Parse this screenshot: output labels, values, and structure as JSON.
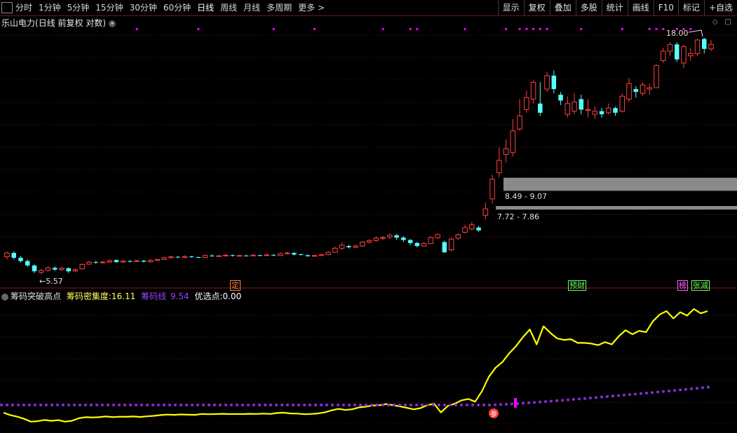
{
  "toolbar": {
    "periods": [
      "分时",
      "1分钟",
      "5分钟",
      "15分钟",
      "30分钟",
      "60分钟",
      "日线",
      "周线",
      "月线",
      "多周期",
      "更多 >"
    ],
    "active_period": "日线",
    "buttons": [
      "显示",
      "复权",
      "叠加",
      "多股",
      "统计",
      "画线",
      "F10",
      "标记",
      "+自选"
    ]
  },
  "header": {
    "stock_name": "乐山电力",
    "params": "(日线 前复权 对数)"
  },
  "price_labels": {
    "high": "18.00",
    "low": "5.57",
    "zone_upper": "8.49 - 9.07",
    "zone_lower": "7.72 - 7.86"
  },
  "event_tags": {
    "ding": "定",
    "yucai": "预财",
    "bang": "榜",
    "zhangjian": "张减"
  },
  "indicator": {
    "name": "筹码突破高点",
    "density_label": "筹码密集度:",
    "density_value": "16.11",
    "line_label": "筹码线",
    "line_value": "9.54",
    "pick_label": "优选点:",
    "pick_value": "0.00",
    "marker_text": "参"
  },
  "colors": {
    "up": "#ff4040",
    "down": "#54ffff",
    "grid": "#6a1010",
    "magenta": "#ff00ff",
    "yellow": "#ffff00",
    "purple": "#8a2be2"
  },
  "chart_data": {
    "type": "candlestick",
    "candles": [
      [
        6.08,
        6.2,
        6.24,
        6.0
      ],
      [
        6.2,
        6.05,
        6.25,
        6.0
      ],
      [
        6.05,
        5.95,
        6.1,
        5.9
      ],
      [
        5.95,
        5.82,
        6.0,
        5.78
      ],
      [
        5.82,
        5.65,
        5.85,
        5.6
      ],
      [
        5.62,
        5.68,
        5.72,
        5.57
      ],
      [
        5.68,
        5.75,
        5.8,
        5.64
      ],
      [
        5.75,
        5.7,
        5.79,
        5.66
      ],
      [
        5.7,
        5.74,
        5.78,
        5.66
      ],
      [
        5.74,
        5.65,
        5.76,
        5.6
      ],
      [
        5.66,
        5.7,
        5.73,
        5.62
      ],
      [
        5.72,
        5.85,
        5.88,
        5.7
      ],
      [
        5.86,
        5.92,
        5.96,
        5.84
      ],
      [
        5.92,
        5.9,
        5.96,
        5.87
      ],
      [
        5.9,
        5.92,
        5.96,
        5.88
      ],
      [
        5.92,
        5.96,
        6.0,
        5.9
      ],
      [
        5.98,
        5.92,
        6.0,
        5.9
      ],
      [
        5.92,
        5.95,
        5.98,
        5.9
      ],
      [
        5.95,
        5.94,
        5.98,
        5.91
      ],
      [
        5.94,
        5.96,
        5.99,
        5.92
      ],
      [
        5.96,
        5.93,
        5.98,
        5.91
      ],
      [
        5.93,
        5.97,
        6.0,
        5.91
      ],
      [
        5.97,
        6.0,
        6.03,
        5.95
      ],
      [
        6.0,
        6.05,
        6.08,
        5.98
      ],
      [
        6.05,
        6.08,
        6.11,
        6.03
      ],
      [
        6.08,
        6.06,
        6.1,
        6.04
      ],
      [
        6.06,
        6.09,
        6.12,
        6.04
      ],
      [
        6.09,
        6.07,
        6.11,
        6.05
      ],
      [
        6.07,
        6.06,
        6.09,
        6.04
      ],
      [
        6.06,
        6.12,
        6.15,
        6.05
      ],
      [
        6.12,
        6.1,
        6.15,
        6.08
      ],
      [
        6.1,
        6.11,
        6.14,
        6.08
      ],
      [
        6.11,
        6.13,
        6.16,
        6.09
      ],
      [
        6.13,
        6.11,
        6.15,
        6.09
      ],
      [
        6.11,
        6.12,
        6.14,
        6.09
      ],
      [
        6.12,
        6.11,
        6.14,
        6.09
      ],
      [
        6.11,
        6.13,
        6.16,
        6.1
      ],
      [
        6.13,
        6.12,
        6.15,
        6.1
      ],
      [
        6.12,
        6.14,
        6.17,
        6.1
      ],
      [
        6.14,
        6.12,
        6.16,
        6.1
      ],
      [
        6.12,
        6.18,
        6.21,
        6.1
      ],
      [
        6.18,
        6.2,
        6.24,
        6.15
      ],
      [
        6.2,
        6.15,
        6.23,
        6.12
      ],
      [
        6.16,
        6.14,
        6.18,
        6.12
      ],
      [
        6.13,
        6.1,
        6.16,
        6.08
      ],
      [
        6.1,
        6.12,
        6.15,
        6.08
      ],
      [
        6.12,
        6.15,
        6.18,
        6.1
      ],
      [
        6.15,
        6.22,
        6.26,
        6.13
      ],
      [
        6.22,
        6.35,
        6.4,
        6.2
      ],
      [
        6.35,
        6.45,
        6.55,
        6.3
      ],
      [
        6.42,
        6.38,
        6.46,
        6.34
      ],
      [
        6.38,
        6.42,
        6.47,
        6.35
      ],
      [
        6.42,
        6.55,
        6.58,
        6.4
      ],
      [
        6.55,
        6.6,
        6.65,
        6.5
      ],
      [
        6.6,
        6.68,
        6.75,
        6.56
      ],
      [
        6.68,
        6.7,
        6.75,
        6.62
      ],
      [
        6.72,
        6.78,
        6.85,
        6.66
      ],
      [
        6.78,
        6.7,
        6.82,
        6.62
      ],
      [
        6.7,
        6.62,
        6.75,
        6.55
      ],
      [
        6.62,
        6.52,
        6.65,
        6.45
      ],
      [
        6.52,
        6.42,
        6.56,
        6.38
      ],
      [
        6.42,
        6.5,
        6.55,
        6.4
      ],
      [
        6.5,
        6.7,
        6.75,
        6.48
      ],
      [
        6.7,
        6.8,
        6.85,
        6.65
      ],
      [
        6.55,
        6.22,
        6.6,
        6.2
      ],
      [
        6.3,
        6.65,
        6.7,
        6.25
      ],
      [
        6.68,
        6.8,
        6.85,
        6.62
      ],
      [
        6.88,
        7.05,
        7.15,
        6.85
      ],
      [
        7.0,
        7.15,
        7.25,
        6.95
      ],
      [
        7.05,
        6.95,
        7.1,
        6.9
      ],
      [
        7.5,
        7.75,
        8.0,
        7.35
      ],
      [
        8.15,
        9.0,
        9.2,
        7.95
      ],
      [
        9.3,
        9.9,
        10.6,
        9.1
      ],
      [
        10.2,
        10.5,
        11.0,
        9.8
      ],
      [
        10.3,
        11.5,
        12.2,
        10.1
      ],
      [
        11.6,
        12.4,
        13.5,
        11.5
      ],
      [
        12.8,
        13.6,
        14.1,
        12.6
      ],
      [
        13.5,
        14.7,
        14.9,
        13.2
      ],
      [
        13.2,
        12.6,
        14.7,
        12.4
      ],
      [
        14.2,
        15.2,
        15.5,
        14.0
      ],
      [
        15.2,
        14.2,
        15.6,
        13.9
      ],
      [
        13.8,
        13.4,
        14.0,
        13.1
      ],
      [
        12.5,
        13.2,
        13.7,
        12.3
      ],
      [
        12.7,
        13.3,
        13.9,
        12.5
      ],
      [
        13.5,
        12.8,
        13.8,
        12.5
      ],
      [
        12.8,
        12.8,
        13.5,
        12.3
      ],
      [
        12.5,
        12.7,
        13.0,
        12.2
      ],
      [
        12.7,
        12.5,
        12.9,
        12.3
      ],
      [
        12.6,
        12.9,
        13.2,
        12.5
      ],
      [
        12.9,
        12.6,
        13.0,
        12.4
      ],
      [
        12.7,
        13.7,
        13.9,
        12.6
      ],
      [
        13.5,
        14.6,
        15.0,
        13.3
      ],
      [
        14.2,
        14.0,
        14.4,
        13.6
      ],
      [
        13.9,
        14.5,
        14.7,
        13.7
      ],
      [
        14.2,
        14.3,
        14.6,
        13.8
      ],
      [
        14.3,
        16.0,
        16.1,
        14.3
      ],
      [
        16.4,
        17.2,
        17.5,
        16.2
      ],
      [
        17.2,
        17.8,
        18.0,
        16.8
      ],
      [
        17.8,
        16.5,
        18.0,
        16.3
      ],
      [
        16.2,
        17.6,
        17.8,
        15.8
      ],
      [
        16.8,
        17.0,
        17.5,
        16.4
      ],
      [
        17.0,
        18.2,
        18.3,
        16.8
      ],
      [
        18.3,
        17.4,
        18.4,
        17.0
      ],
      [
        17.4,
        17.8,
        18.2,
        17.2
      ]
    ]
  }
}
